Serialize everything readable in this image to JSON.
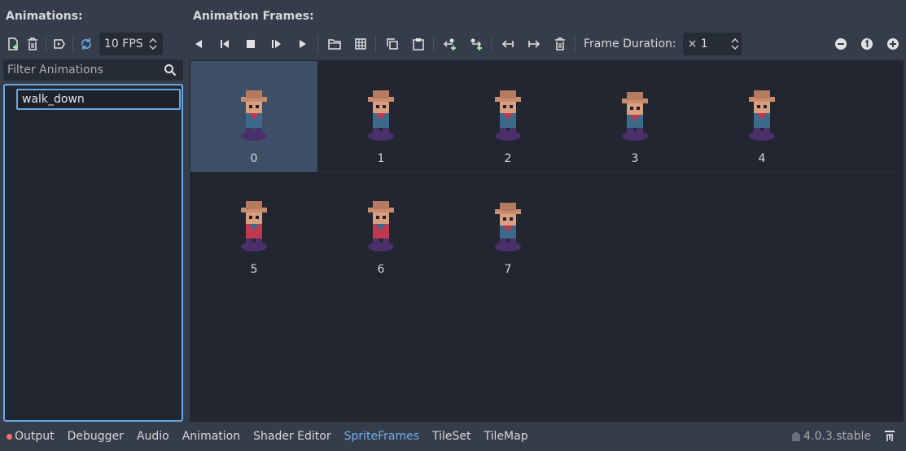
{
  "left": {
    "title": "Animations:",
    "fps": "10 FPS",
    "filter_placeholder": "Filter Animations",
    "animations": [
      "walk_down"
    ]
  },
  "right": {
    "title": "Animation Frames:",
    "frame_duration_label": "Frame Duration:",
    "frame_duration_value": "× 1",
    "frames": [
      "0",
      "1",
      "2",
      "3",
      "4",
      "5",
      "6",
      "7"
    ],
    "selected_frame": 0
  },
  "bottom": {
    "tabs": [
      "Output",
      "Debugger",
      "Audio",
      "Animation",
      "Shader Editor",
      "SpriteFrames",
      "TileSet",
      "TileMap"
    ],
    "active_tab": "SpriteFrames",
    "version": "4.0.3.stable"
  },
  "colors": {
    "accent": "#67a8e2",
    "active_tab": "#6eaeef",
    "selection": "#3d4f66"
  }
}
